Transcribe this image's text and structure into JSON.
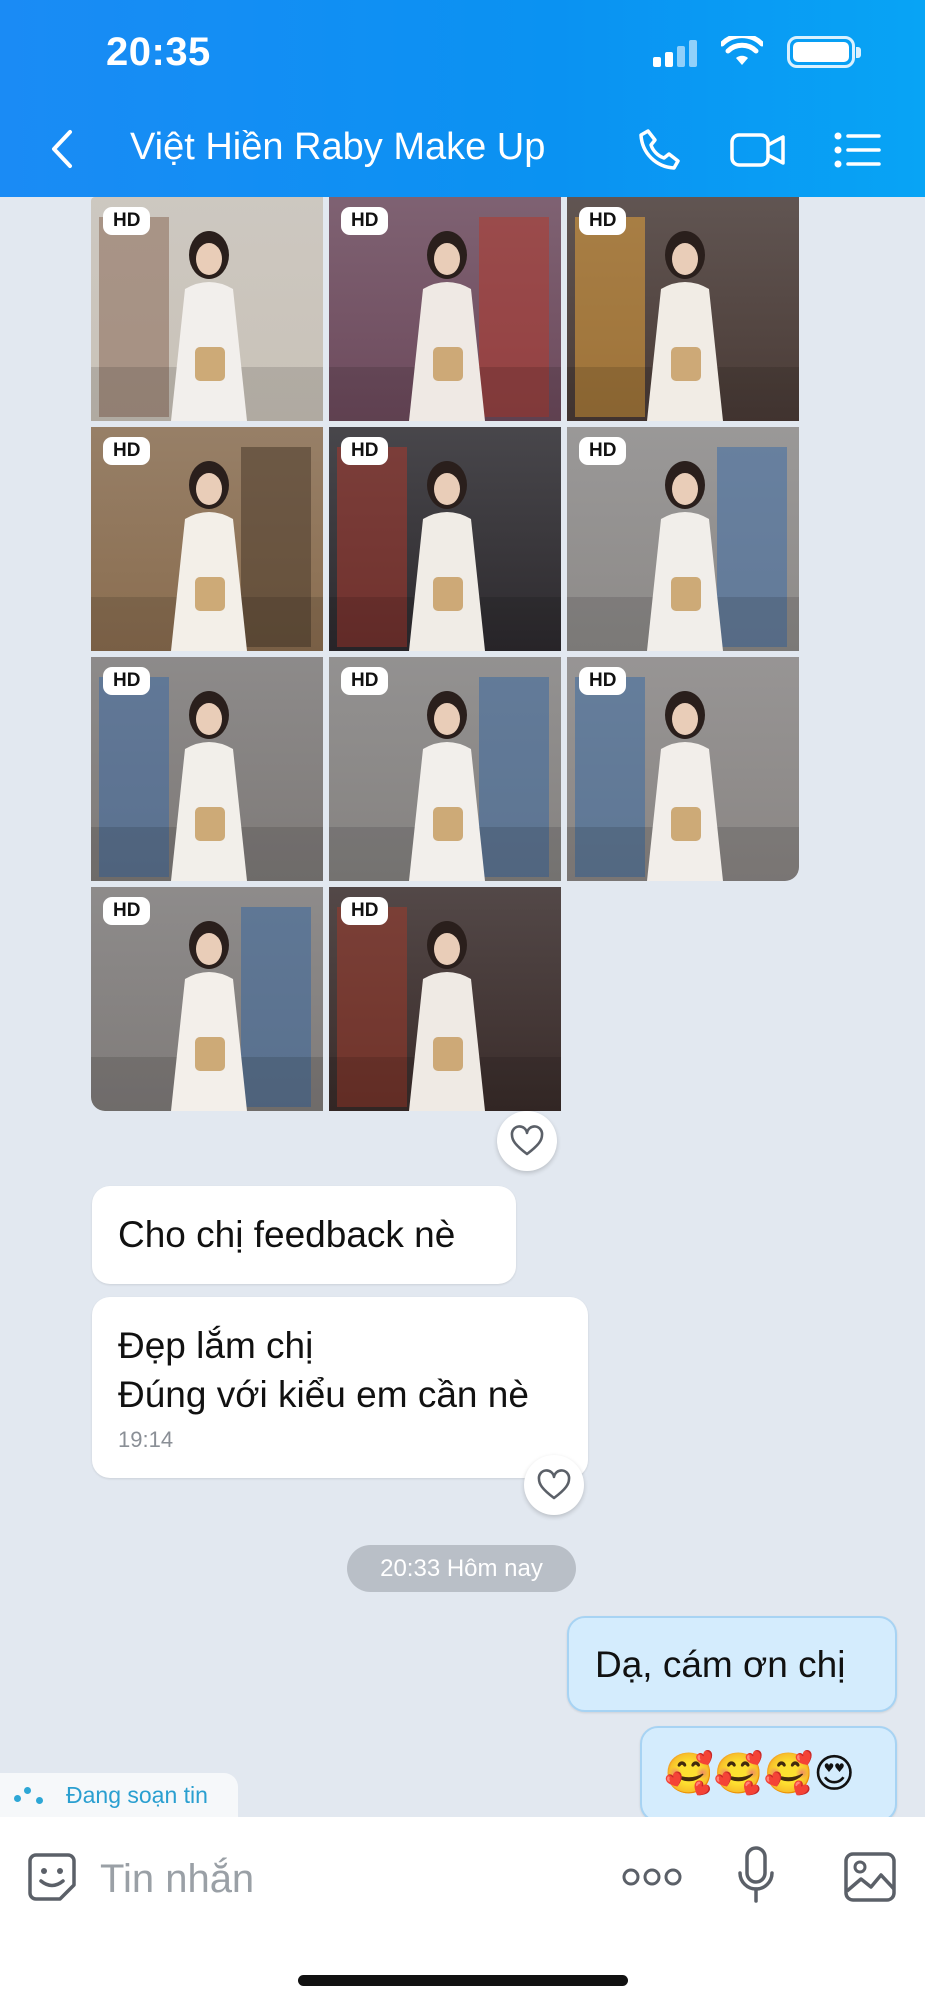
{
  "status_bar": {
    "time": "20:35"
  },
  "header": {
    "title": "Việt Hiền Raby Make Up",
    "icons": [
      "back-icon",
      "phone-icon",
      "video-camera-icon",
      "menu-icon"
    ]
  },
  "photo_album": {
    "badge_label": "HD",
    "photos": [
      {
        "badge": "HD",
        "scene": "incense-temple",
        "colors": [
          "#c9c2b8",
          "#8a6a58",
          "#f2efec"
        ]
      },
      {
        "badge": "HD",
        "scene": "temple-door-red",
        "colors": [
          "#6d4a5c",
          "#b23a2e",
          "#efe9e4"
        ]
      },
      {
        "badge": "HD",
        "scene": "incense-glow",
        "colors": [
          "#4a3b36",
          "#e3a23c",
          "#f1ece5"
        ]
      },
      {
        "badge": "HD",
        "scene": "wooden-sign",
        "colors": [
          "#8a6d4f",
          "#4a3a2c",
          "#f3efe8"
        ]
      },
      {
        "badge": "HD",
        "scene": "red-gate",
        "colors": [
          "#2d2a2e",
          "#a8382d",
          "#f0ece6"
        ]
      },
      {
        "badge": "HD",
        "scene": "cyclo-street",
        "colors": [
          "#8d8a88",
          "#3f6ea6",
          "#f1eeea"
        ]
      },
      {
        "badge": "HD",
        "scene": "cyclo-front",
        "colors": [
          "#7e7a78",
          "#3e6aa3",
          "#f2efea"
        ]
      },
      {
        "badge": "HD",
        "scene": "cyclo-side",
        "colors": [
          "#858280",
          "#3c69a0",
          "#f2efeb"
        ]
      },
      {
        "badge": "HD",
        "scene": "cyclo-front-2",
        "colors": [
          "#8a8684",
          "#3d6ba2",
          "#f2eeea"
        ]
      },
      {
        "badge": "HD",
        "scene": "cyclo-lean",
        "colors": [
          "#7f7b79",
          "#3a679e",
          "#f3efea"
        ]
      },
      {
        "badge": "HD",
        "scene": "temple-doorway",
        "colors": [
          "#3a2c2a",
          "#9c3a2c",
          "#efeae4"
        ]
      }
    ]
  },
  "messages": {
    "incoming_1": "Cho chị feedback nè",
    "incoming_2_line1": "Đẹp lắm chị",
    "incoming_2_line2": "Đúng với kiểu em cần nè",
    "incoming_2_time": "19:14",
    "date_separator": "20:33 Hôm nay",
    "outgoing_1": "Dạ, cám ơn chị",
    "outgoing_2": "🥰🥰🥰😍"
  },
  "typing_indicator": {
    "label": "Đang soạn tin"
  },
  "composer": {
    "placeholder": "Tin nhắn",
    "icons": [
      "sticker-icon",
      "more-icon",
      "microphone-icon",
      "image-icon"
    ]
  },
  "theme": {
    "header_blue": "#1a8bf5",
    "background": "#e2e8f0",
    "outgoing_bubble": "#d4ecfd",
    "typing_text": "#2a9fd0"
  }
}
